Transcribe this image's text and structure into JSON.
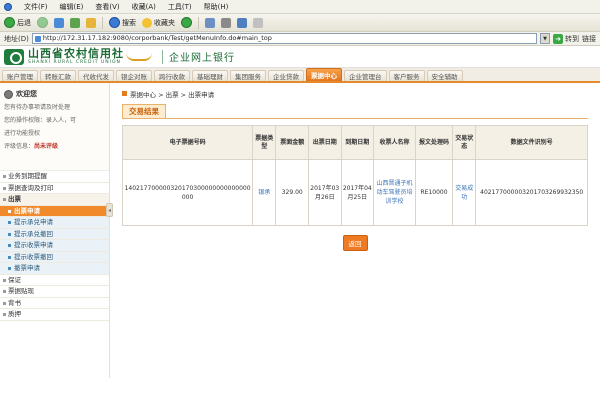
{
  "browser": {
    "menu": [
      "文件(F)",
      "编辑(E)",
      "查看(V)",
      "收藏(A)",
      "工具(T)",
      "帮助(H)"
    ],
    "toolbar": {
      "back": "后退",
      "search": "搜索",
      "favorites": "收藏夹"
    },
    "address_label": "地址(D)",
    "url": "http://172.31.17.182:9080/corporbank/Test/getMenuInfo.do#main_top",
    "go_label": "转到",
    "links_label": "链接"
  },
  "bank": {
    "name_cn": "山西省农村信用社",
    "name_en": "SHANXI RURAL CREDIT UNION",
    "subtitle": "企业网上银行"
  },
  "nav": {
    "tabs": [
      "账户管理",
      "转账汇款",
      "代收代发",
      "银企对账",
      "跨行收款",
      "基础理财",
      "集团服务",
      "企业贷款",
      "票据中心",
      "企业管理台",
      "客户服务",
      "安全辅助"
    ],
    "active_index": 8
  },
  "user": {
    "greeting": "欢迎您",
    "lines": [
      "您有待办事项请及时处理",
      "您的操作权限：录入人，可",
      "进行功能授权"
    ],
    "level_label": "评级信息：",
    "level_value": "尚未评级"
  },
  "menu": [
    {
      "label": "业务到期提醒",
      "kind": "top"
    },
    {
      "label": "票据查询及打印",
      "kind": "top"
    },
    {
      "label": "出票",
      "kind": "parent"
    },
    {
      "label": "出票申请",
      "kind": "sub",
      "selected": true
    },
    {
      "label": "提示承兑申请",
      "kind": "sub"
    },
    {
      "label": "提示承兑撤回",
      "kind": "sub"
    },
    {
      "label": "提示收票申请",
      "kind": "sub"
    },
    {
      "label": "提示收票撤回",
      "kind": "sub"
    },
    {
      "label": "撤票申请",
      "kind": "sub"
    },
    {
      "label": "保证",
      "kind": "top"
    },
    {
      "label": "票据贴现",
      "kind": "top"
    },
    {
      "label": "背书",
      "kind": "top"
    },
    {
      "label": "质押",
      "kind": "top"
    }
  ],
  "content": {
    "breadcrumb": "票据中心 > 出票 > 出票申请",
    "section_title": "交易结果",
    "table": {
      "headers": [
        "电子票据号码",
        "票据类型",
        "票面金额",
        "出票日期",
        "到期日期",
        "收票人名称",
        "报文处理码",
        "交易状态",
        "数据文件识别号"
      ],
      "row": [
        "140217700000320170300000000000000000",
        "银承",
        "329.00",
        "2017年03月26日",
        "2017年04月25日",
        "山西晋通子机动车驾驶员培训学校",
        "RE10000",
        "交易成功",
        "402177000003201703269932350"
      ]
    },
    "back_button": "返回"
  }
}
